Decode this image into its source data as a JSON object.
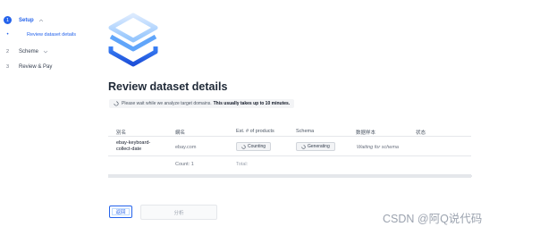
{
  "sidebar": {
    "steps": [
      {
        "number": "1",
        "label": "Setup",
        "state": "active"
      },
      {
        "number": "2",
        "label": "Scheme"
      },
      {
        "number": "3",
        "label": "Review & Pay"
      }
    ],
    "substep": {
      "bullet": "•",
      "label": "Review dataset details"
    }
  },
  "main": {
    "title": "Review dataset details",
    "notice": {
      "text": "Please wait while we analyze target domains.",
      "bold": "This usually takes up to 10 minutes."
    },
    "table": {
      "headers": [
        "別名",
        "網名",
        "Est. # of products",
        "Schema",
        "数据样本",
        "状态"
      ],
      "row": {
        "alias_line1": "ebay-keyboard-",
        "alias_line2": "collect-date",
        "domain": "ebay.com",
        "products": "Counting",
        "schema": "Generating",
        "sample": "Waiting for schema"
      },
      "footer": {
        "count": "Count: 1",
        "total": "Total:"
      }
    },
    "buttons": {
      "back": "返回",
      "next": "分析"
    }
  },
  "watermark": "CSDN @阿Q说代码",
  "colors": {
    "accent": "#2563eb",
    "border": "#e5e7eb"
  }
}
